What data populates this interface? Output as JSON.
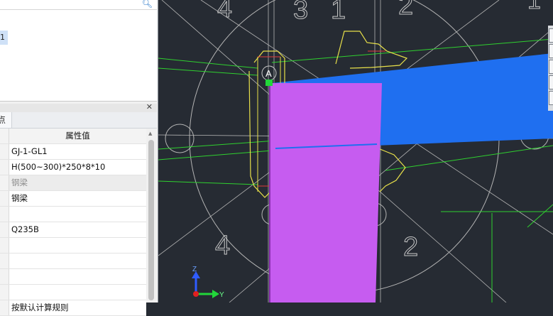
{
  "tree": {
    "selected_item": "1"
  },
  "properties": {
    "tab": "点",
    "header": "属性值",
    "rows": [
      {
        "label": "",
        "value": "GJ-1-GL1",
        "gray": false
      },
      {
        "label": "",
        "value": "H(500~300)*250*8*10",
        "gray": false
      },
      {
        "label": "",
        "value": "钢梁",
        "gray": true
      },
      {
        "label": "",
        "value": "钢梁",
        "gray": false
      },
      {
        "label": "",
        "value": "",
        "gray": false
      },
      {
        "label": "",
        "value": "Q235B",
        "gray": false
      },
      {
        "label": "",
        "value": "",
        "gray": false
      },
      {
        "label": "",
        "value": "",
        "gray": false
      },
      {
        "label": "",
        "value": "",
        "gray": false
      },
      {
        "label": "",
        "value": "",
        "gray": false
      },
      {
        "label": "",
        "value": "按默认计算规则",
        "gray": false
      }
    ]
  },
  "canvas": {
    "axis_numbers": {
      "n4": "4",
      "n3": "3",
      "n1": "1",
      "n2": "2",
      "n1b": "1"
    },
    "point_label": "A",
    "axes": {
      "z": "Z",
      "y": "Y"
    },
    "colors": {
      "background": "#262b33",
      "beam": "#1f6ff0",
      "column": "#c65cf0",
      "steel": "#e8e04a",
      "guide": "#2fd12f",
      "axis_circle": "#b4b4b4"
    }
  }
}
